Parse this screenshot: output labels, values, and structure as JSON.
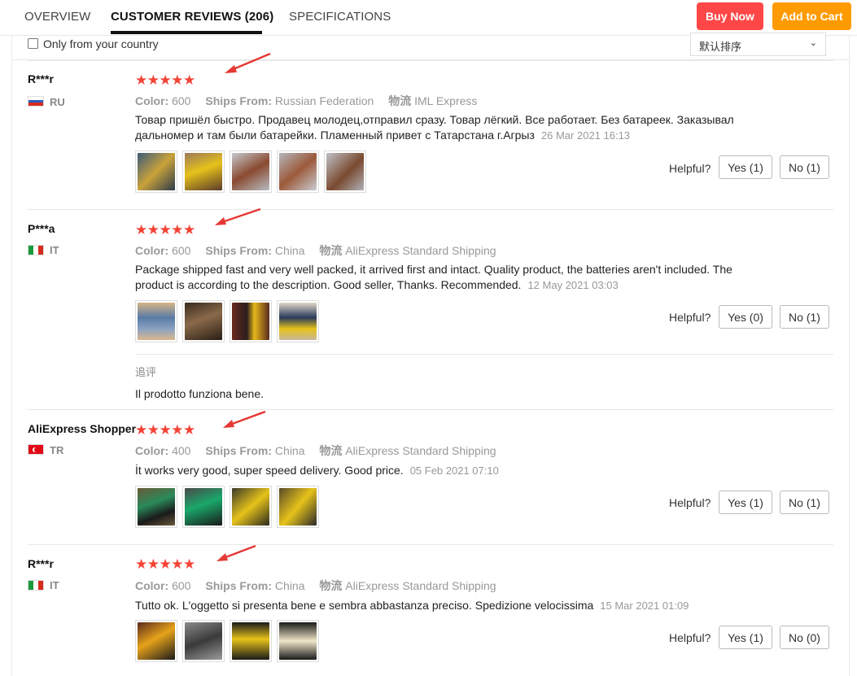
{
  "tabs": [
    {
      "label": "OVERVIEW"
    },
    {
      "label": "CUSTOMER REVIEWS (206)"
    },
    {
      "label": "SPECIFICATIONS"
    }
  ],
  "buttons": {
    "buy_now": "Buy Now",
    "add_to_cart": "Add to Cart"
  },
  "filter": {
    "country_only": "Only from your country",
    "sort": "默认排序",
    "sort_chevron": "⌄"
  },
  "labels": {
    "color": "Color:",
    "ships_from": "Ships From:",
    "logistics": "物流",
    "helpful": "Helpful?",
    "stars": "★★★★★",
    "additional": "追评"
  },
  "colors": {
    "accent_red": "#ff4747",
    "accent_orange": "#ff9a00",
    "star": "#f44336"
  },
  "reviews": [
    {
      "name": "R***r",
      "country": "RU",
      "color": "600",
      "ships_from": "Russian Federation",
      "logistics": "IML Express",
      "text": "Товар пришёл быстро. Продавец молодец,отправил сразу. Товар лёгкий. Все работает. Без батареек. Заказывал дальномер и там были батарейки. Пламенный привет с Татарстана г.Агрыз",
      "date": "26 Mar 2021 16:13",
      "yes": "Yes (1)",
      "no": "No (1)"
    },
    {
      "name": "P***a",
      "country": "IT",
      "color": "600",
      "ships_from": "China",
      "logistics": "AliExpress Standard Shipping",
      "text": "Package shipped fast and very well packed, it arrived first and intact. Quality product, the batteries aren't included. The product is according to the description. Good seller, Thanks. Recommended.",
      "date": "12 May 2021 03:03",
      "yes": "Yes (0)",
      "no": "No (1)",
      "additional": "Il prodotto funziona bene."
    },
    {
      "name": "AliExpress Shopper",
      "country": "TR",
      "color": "400",
      "ships_from": "China",
      "logistics": "AliExpress Standard Shipping",
      "text": "İt works very good, super speed delivery. Good price.",
      "date": "05 Feb 2021 07:10",
      "yes": "Yes (1)",
      "no": "No (1)"
    },
    {
      "name": "R***r",
      "country": "IT",
      "color": "600",
      "ships_from": "China",
      "logistics": "AliExpress Standard Shipping",
      "text": "Tutto ok. L'oggetto si presenta bene e sembra abbastanza preciso. Spedizione velocissima",
      "date": "15 Mar 2021 01:09",
      "yes": "Yes (1)",
      "no": "No (0)"
    }
  ]
}
